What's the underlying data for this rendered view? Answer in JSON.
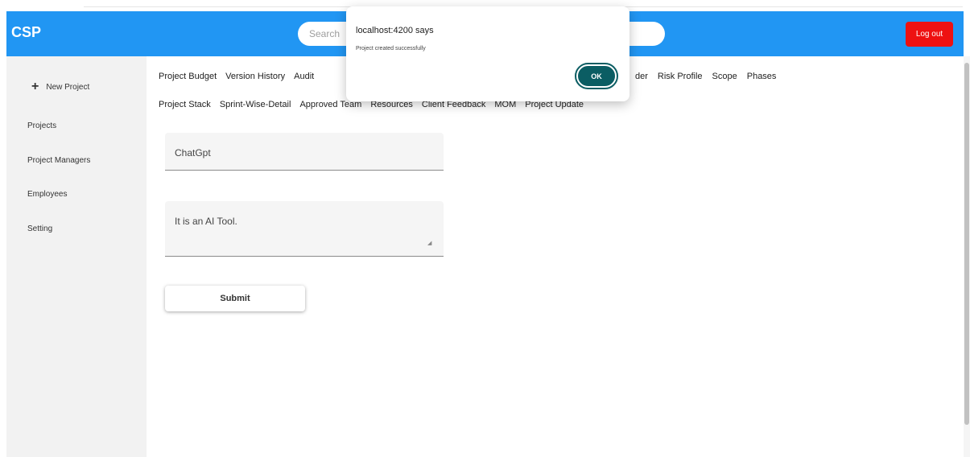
{
  "app": {
    "title": "CSP"
  },
  "header": {
    "search_placeholder": "Search",
    "logout_label": "Log out"
  },
  "sidebar": {
    "new_project": "New Project",
    "items": [
      {
        "label": "Projects"
      },
      {
        "label": "Project Managers"
      },
      {
        "label": "Employees"
      },
      {
        "label": "Setting"
      }
    ]
  },
  "tabs": {
    "row1": [
      "Project Budget",
      "Version History",
      "Audit"
    ],
    "row1_right": [
      "der",
      "Risk Profile",
      "Scope",
      "Phases"
    ],
    "row2": [
      "Project Stack",
      "Sprint-Wise-Detail",
      "Approved Team",
      "Resources",
      "Client Feedback",
      "MOM",
      "Project Update"
    ]
  },
  "form": {
    "name_value": "ChatGpt",
    "description_value": "It is an AI Tool.",
    "submit_label": "Submit"
  },
  "dialog": {
    "title": "localhost:4200 says",
    "message": "Project created successfully",
    "ok_label": "OK"
  },
  "colors": {
    "appbar": "#2196f3",
    "logout": "#ee1111",
    "ok_button": "#0b5d63",
    "sidebar": "#f2f2f2"
  }
}
